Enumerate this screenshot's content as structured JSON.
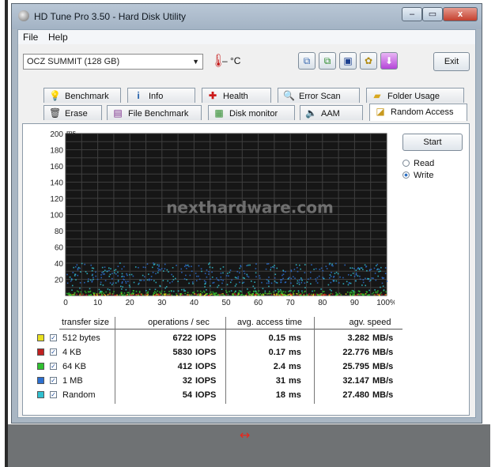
{
  "window": {
    "title": "HD Tune Pro 3.50 - Hard Disk Utility",
    "controls": {
      "minimize": "–",
      "maximize": "▭",
      "close": "x"
    }
  },
  "menu": {
    "file": "File",
    "help": "Help"
  },
  "toolbar": {
    "drive": "OCZ SUMMIT (128 GB)",
    "temperature": "– °C",
    "exit": "Exit",
    "icons": [
      "copy-icon",
      "copy-all-icon",
      "save-icon",
      "options-icon",
      "download-icon"
    ]
  },
  "tabs": {
    "row1": [
      {
        "label": "Benchmark",
        "icon": "bulb-icon"
      },
      {
        "label": "Info",
        "icon": "info-icon"
      },
      {
        "label": "Health",
        "icon": "health-icon"
      },
      {
        "label": "Error Scan",
        "icon": "magnifier-icon"
      },
      {
        "label": "Folder Usage",
        "icon": "folder-icon"
      }
    ],
    "row2": [
      {
        "label": "Erase",
        "icon": "trash-icon"
      },
      {
        "label": "File Benchmark",
        "icon": "file-benchmark-icon"
      },
      {
        "label": "Disk monitor",
        "icon": "monitor-icon"
      },
      {
        "label": "AAM",
        "icon": "speaker-icon"
      },
      {
        "label": "Random Access",
        "icon": "random-access-icon"
      }
    ],
    "active": "Random Access"
  },
  "controls": {
    "start": "Start",
    "mode_options": [
      "Read",
      "Write"
    ],
    "mode_selected": "Write"
  },
  "chart_data": {
    "type": "scatter",
    "watermark": "nexthardware.com",
    "ylabel": "ms",
    "ylim": [
      0,
      200
    ],
    "xlim": [
      0,
      100
    ],
    "y_ticks": [
      "200",
      "180",
      "160",
      "140",
      "120",
      "100",
      "80",
      "60",
      "40",
      "20"
    ],
    "x_ticks": [
      "0",
      "10",
      "20",
      "30",
      "40",
      "50",
      "60",
      "70",
      "80",
      "90",
      "100%"
    ],
    "grid": true,
    "series": [
      {
        "name": "512 bytes",
        "color": "#e8e020",
        "y_min": 0,
        "y_max": 2
      },
      {
        "name": "4 KB",
        "color": "#c02020",
        "y_min": 0,
        "y_max": 2
      },
      {
        "name": "64 KB",
        "color": "#30c030",
        "y_min": 0,
        "y_max": 6
      },
      {
        "name": "1 MB",
        "color": "#2c6fd0",
        "y_min": 15,
        "y_max": 40
      },
      {
        "name": "Random",
        "color": "#30c0d0",
        "y_min": 5,
        "y_max": 40
      }
    ]
  },
  "results": {
    "headers": [
      "transfer size",
      "operations / sec",
      "avg. access time",
      "agv. speed"
    ],
    "rows": [
      {
        "label": "512 bytes",
        "color": "#e8e020",
        "ops": "6722",
        "ops_unit": "IOPS",
        "access": "0.15",
        "access_unit": "ms",
        "speed": "3.282",
        "speed_unit": "MB/s"
      },
      {
        "label": "4 KB",
        "color": "#c02020",
        "ops": "5830",
        "ops_unit": "IOPS",
        "access": "0.17",
        "access_unit": "ms",
        "speed": "22.776",
        "speed_unit": "MB/s"
      },
      {
        "label": "64 KB",
        "color": "#30c030",
        "ops": "412",
        "ops_unit": "IOPS",
        "access": "2.4",
        "access_unit": "ms",
        "speed": "25.795",
        "speed_unit": "MB/s"
      },
      {
        "label": "1 MB",
        "color": "#2c6fd0",
        "ops": "32",
        "ops_unit": "IOPS",
        "access": "31",
        "access_unit": "ms",
        "speed": "32.147",
        "speed_unit": "MB/s"
      },
      {
        "label": "Random",
        "color": "#30c0d0",
        "ops": "54",
        "ops_unit": "IOPS",
        "access": "18",
        "access_unit": "ms",
        "speed": "27.480",
        "speed_unit": "MB/s"
      }
    ]
  },
  "footer": {
    "resize_glyph": "↔"
  }
}
